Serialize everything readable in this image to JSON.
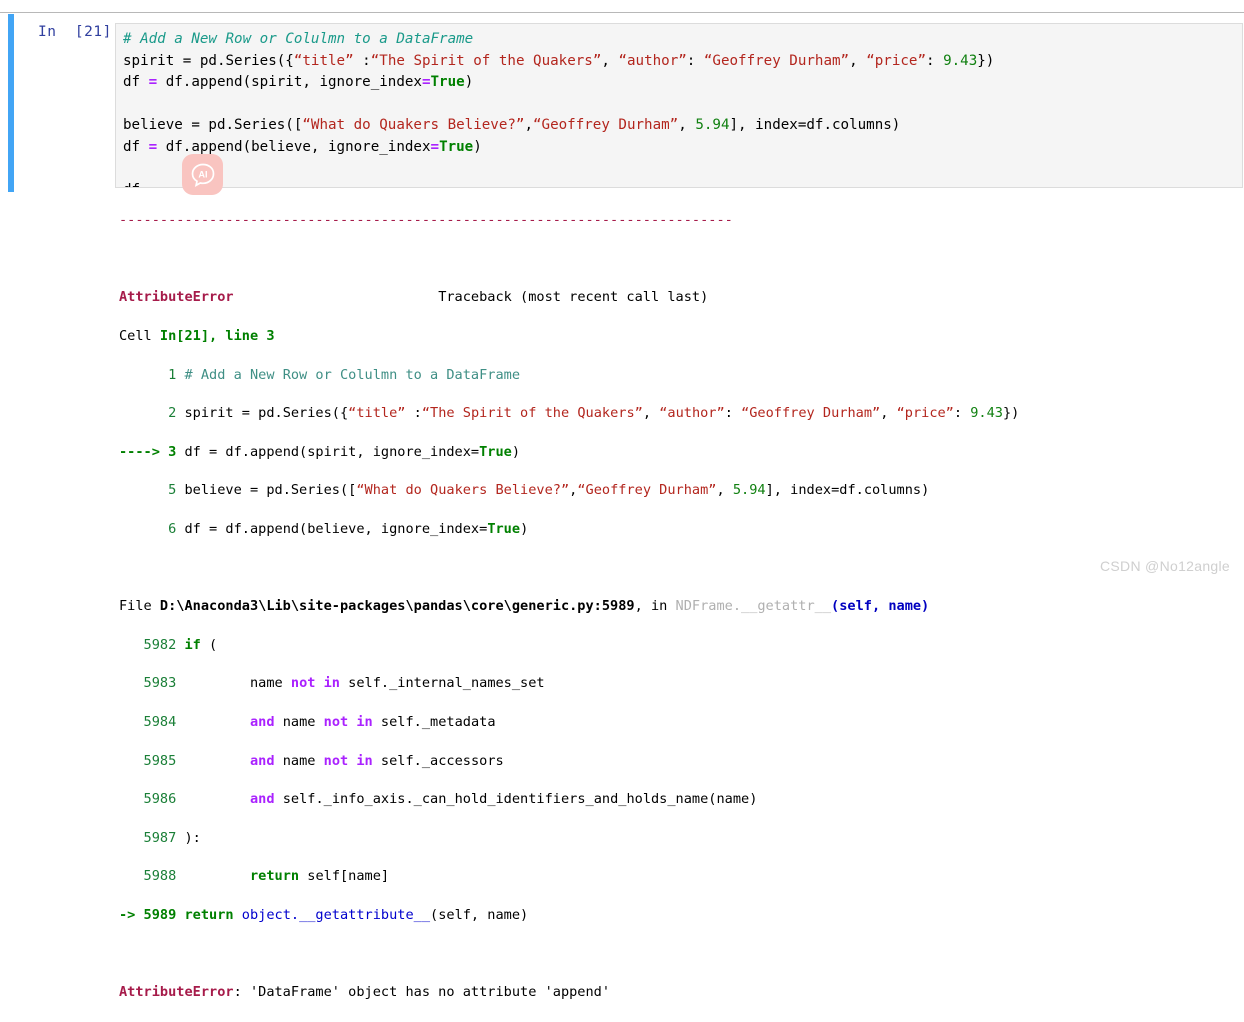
{
  "notebook": {
    "prompt_label": "In  [21]:",
    "execution_count": 21,
    "cell": {
      "line1_comment": "# Add a New Row or Colulmn to a DataFrame",
      "line2": {
        "lhs": "spirit = pd.Series({",
        "k_title": "“title”",
        "sep1": " :",
        "v_title": "“The Spirit of the Quakers”",
        "comma1": ", ",
        "k_author": "“author”",
        "sep2": ": ",
        "v_author": "“Geoffrey Durham”",
        "comma2": ", ",
        "k_price": "“price”",
        "sep3": ": ",
        "v_price": "9.43",
        "rhs": "})"
      },
      "line3": {
        "a": "df ",
        "eq": "=",
        "b": " df.append(spirit, ignore_index",
        "eq2": "=",
        "t": "True",
        "c": ")"
      },
      "line5": {
        "lhs": "believe = pd.Series([",
        "v_q": "“What do Quakers Believe?”",
        "comma1": ",",
        "v_author": "“Geoffrey Durham”",
        "comma2": ", ",
        "v_price": "5.94",
        "rhs": "], index=df.columns)"
      },
      "line6": {
        "a": "df ",
        "eq": "=",
        "b": " df.append(believe, ignore_index",
        "eq2": "=",
        "t": "True",
        "c": ")"
      },
      "line8": "df"
    }
  },
  "ai_badge": {
    "icon": "ai-chat-bubble-icon",
    "label": "AI",
    "color": "#f9c4c0"
  },
  "output": {
    "rule": "---------------------------------------------------------------------------",
    "error_name": "AttributeError",
    "traceback_header": "Traceback (most recent call last)",
    "cell_word": "Cell ",
    "cell_ref": "In[21], line 3",
    "tb_lines": [
      {
        "num": "      1 ",
        "comment": "# Add a New Row or Colulmn to a DataFrame"
      },
      {
        "num": "      2 "
      },
      {
        "num": "----> 3 "
      },
      {
        "num": "      5 "
      },
      {
        "num": "      6 "
      }
    ],
    "tb2_lhs": "spirit = pd.Series({",
    "tb2_k_title": "“title”",
    "tb2_sep1": " :",
    "tb2_v_title": "“The Spirit of the Quakers”",
    "tb2_k_author": "“author”",
    "tb2_v_author": "“Geoffrey Durham”",
    "tb2_k_price": "“price”",
    "tb2_v_price": "9.43",
    "tb2_rhs": "})",
    "tb3_a": "df = df.append(spirit, ignore_index=",
    "tb3_true": "True",
    "tb3_c": ")",
    "tb5_lhs": "believe = pd.Series([",
    "tb5_vq": "“What do Quakers Believe?”",
    "tb5_vauthor": "“Geoffrey Durham”",
    "tb5_vprice": "5.94",
    "tb5_rhs": "], index=df.columns)",
    "tb6_a": "df = df.append(believe, ignore_index=",
    "tb6_true": "True",
    "tb6_c": ")",
    "file_word": "File ",
    "file_path": "D:\\Anaconda3\\Lib\\site-packages\\pandas\\core\\generic.py:5989",
    "file_in": ", in ",
    "file_func": "NDFrame.__getattr__",
    "file_args": "(self, name)",
    "src_lines": [
      {
        "no": "   5982 ",
        "kw": "if",
        "rest": " ("
      },
      {
        "no": "   5983 ",
        "pre": "        name ",
        "kw1": "not in",
        "rest": " self._internal_names_set"
      },
      {
        "no": "   5984 ",
        "pre": "        ",
        "kw0": "and",
        "mid": " name ",
        "kw1": "not in",
        "rest": " self._metadata"
      },
      {
        "no": "   5985 ",
        "pre": "        ",
        "kw0": "and",
        "mid": " name ",
        "kw1": "not in",
        "rest": " self._accessors"
      },
      {
        "no": "   5986 ",
        "pre": "        ",
        "kw0": "and",
        "rest2": " self._info_axis._can_hold_identifiers_and_holds_name(name)"
      },
      {
        "no": "   5987 ",
        "rest": "):"
      },
      {
        "no": "   5988 ",
        "pre": "        ",
        "kw": "return",
        "rest": " self[name]"
      }
    ],
    "last_src_arrow": "-> 5989 ",
    "last_src_kw": "return",
    "last_src_obj": " object.__getattribute__",
    "last_src_args": "(self, name)",
    "final_error_name": "AttributeError",
    "final_error_msg": ": 'DataFrame' object has no attribute 'append'"
  },
  "watermark": {
    "text": "CSDN @No12angle"
  }
}
